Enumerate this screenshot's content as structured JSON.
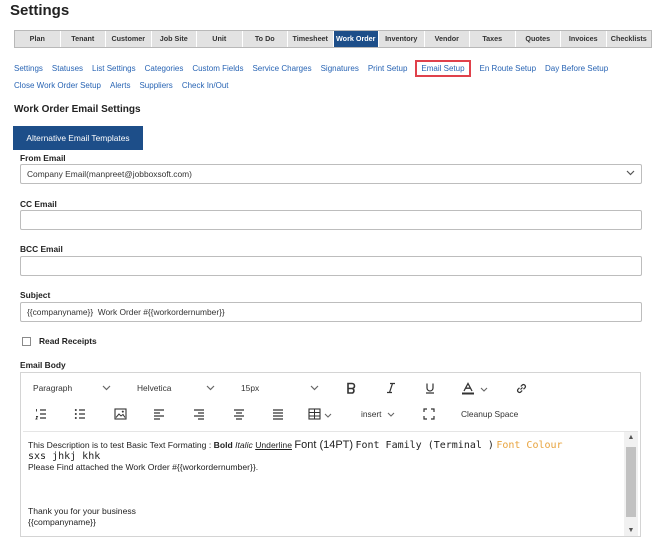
{
  "page": {
    "title": "Settings"
  },
  "main_tabs": [
    {
      "label": "Plan"
    },
    {
      "label": "Tenant"
    },
    {
      "label": "Customer"
    },
    {
      "label": "Job Site"
    },
    {
      "label": "Unit"
    },
    {
      "label": "To Do"
    },
    {
      "label": "Timesheet"
    },
    {
      "label": "Work Order",
      "active": true
    },
    {
      "label": "Inventory"
    },
    {
      "label": "Vendor"
    },
    {
      "label": "Taxes"
    },
    {
      "label": "Quotes"
    },
    {
      "label": "Invoices"
    },
    {
      "label": "Checklists"
    }
  ],
  "sub_links": {
    "row1": [
      "Settings",
      "Statuses",
      "List Settings",
      "Categories",
      "Custom Fields",
      "Service Charges",
      "Signatures",
      "Print Setup",
      "Email Setup",
      "En Route Setup",
      "Day Before Setup"
    ],
    "row2": [
      "Close Work Order Setup",
      "Alerts",
      "Suppliers",
      "Check In/Out"
    ],
    "active": "Email Setup"
  },
  "section": {
    "heading": "Work Order Email Settings",
    "alt_templates_button": "Alternative Email Templates"
  },
  "form": {
    "from_email_label": "From Email",
    "from_email_value": "Company Email(manpreet@jobboxsoft.com)",
    "cc_label": "CC Email",
    "cc_value": "",
    "bcc_label": "BCC Email",
    "bcc_value": "",
    "subject_label": "Subject",
    "subject_value": "{{companyname}}  Work Order #{{workordernumber}}",
    "read_receipts_label": "Read Receipts",
    "read_receipts_checked": false,
    "email_body_label": "Email Body"
  },
  "editor": {
    "paragraph_select": "Paragraph",
    "font_select": "Helvetica",
    "size_select": "15px",
    "insert_label": "insert",
    "cleanup_label": "Cleanup Space",
    "body": {
      "line1_prefix": "This Description is to test Basic Text Formating : ",
      "bold": "Bold",
      "italic": "Italic",
      "underline": "Underline",
      "font_size_text": "Font (14PT)",
      "font_family_text": "Font Family (Terminal )",
      "font_colour_text": "Font Colour",
      "trailing_text": "sxs jhkj khk",
      "line2": "Please Find attached the Work Order #{{workordernumber}}.",
      "thanks": "Thank you for your business",
      "signature": "{{companyname}}"
    },
    "font_colour_hex": "#e8a33d"
  },
  "colors": {
    "accent": "#1d4e89",
    "link": "#2864b4",
    "highlight": "#e0414b"
  }
}
